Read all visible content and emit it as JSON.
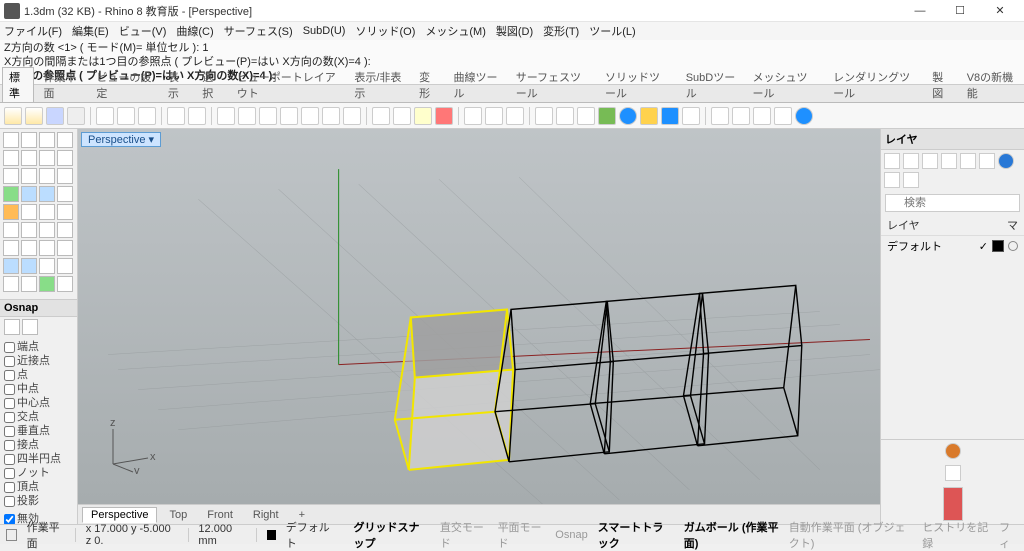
{
  "window": {
    "title": "1.3dm (32 KB) - Rhino 8 教育版 - [Perspective]",
    "min": "—",
    "max": "☐",
    "close": "✕"
  },
  "menu": [
    "ファイル(F)",
    "編集(E)",
    "ビュー(V)",
    "曲線(C)",
    "サーフェス(S)",
    "SubD(U)",
    "ソリッド(O)",
    "メッシュ(M)",
    "製図(D)",
    "変形(T)",
    "ツール(L)"
  ],
  "command": {
    "line1": "Z方向の数 <1> ( モード(M)= 単位セル ): 1",
    "line2": "X方向の間隔または1つ目の参照点 ( プレビュー(P)=はい  X方向の数(X)=4 ):",
    "line3": "2つ目の参照点 ( プレビュー(P)=はい  X方向の数(X)=4 ):"
  },
  "tabs": [
    "標準",
    "作業平面",
    "ビューの設定",
    "表示",
    "選択",
    "ビューポートレイアウト",
    "表示/非表示",
    "変形",
    "曲線ツール",
    "サーフェスツール",
    "ソリッドツール",
    "SubDツール",
    "メッシュツール",
    "レンダリングツール",
    "製図",
    "V8の新機能"
  ],
  "viewport": {
    "label": "Perspective",
    "arrow": "▾"
  },
  "viewtabs": [
    "Perspective",
    "Top",
    "Front",
    "Right",
    "+"
  ],
  "osnap": {
    "title": "Osnap",
    "items": [
      "端点",
      "近接点",
      "点",
      "中点",
      "中心点",
      "交点",
      "垂直点",
      "接点",
      "四半円点",
      "ノット",
      "頂点",
      "投影"
    ],
    "disable": "無効"
  },
  "right": {
    "panel": "レイヤ",
    "search": "検索",
    "colhead_name": "レイヤ",
    "colhead_mat": "マ",
    "row_name": "デフォルト"
  },
  "status": {
    "left": "作業平面",
    "coords": "x 17.000  y -5.000  z 0.",
    "dist": "12.000 mm",
    "layer": "デフォルト",
    "gridsnap": "グリッドスナップ",
    "ortho": "直交モード",
    "planar": "平面モード",
    "osnap": "Osnap",
    "smart": "スマートトラック",
    "gumball": "ガムボール (作業平面)",
    "autocp": "自動作業平面 (オブジェクト)",
    "history": "ヒストリを記録",
    "filter": "フィ"
  }
}
